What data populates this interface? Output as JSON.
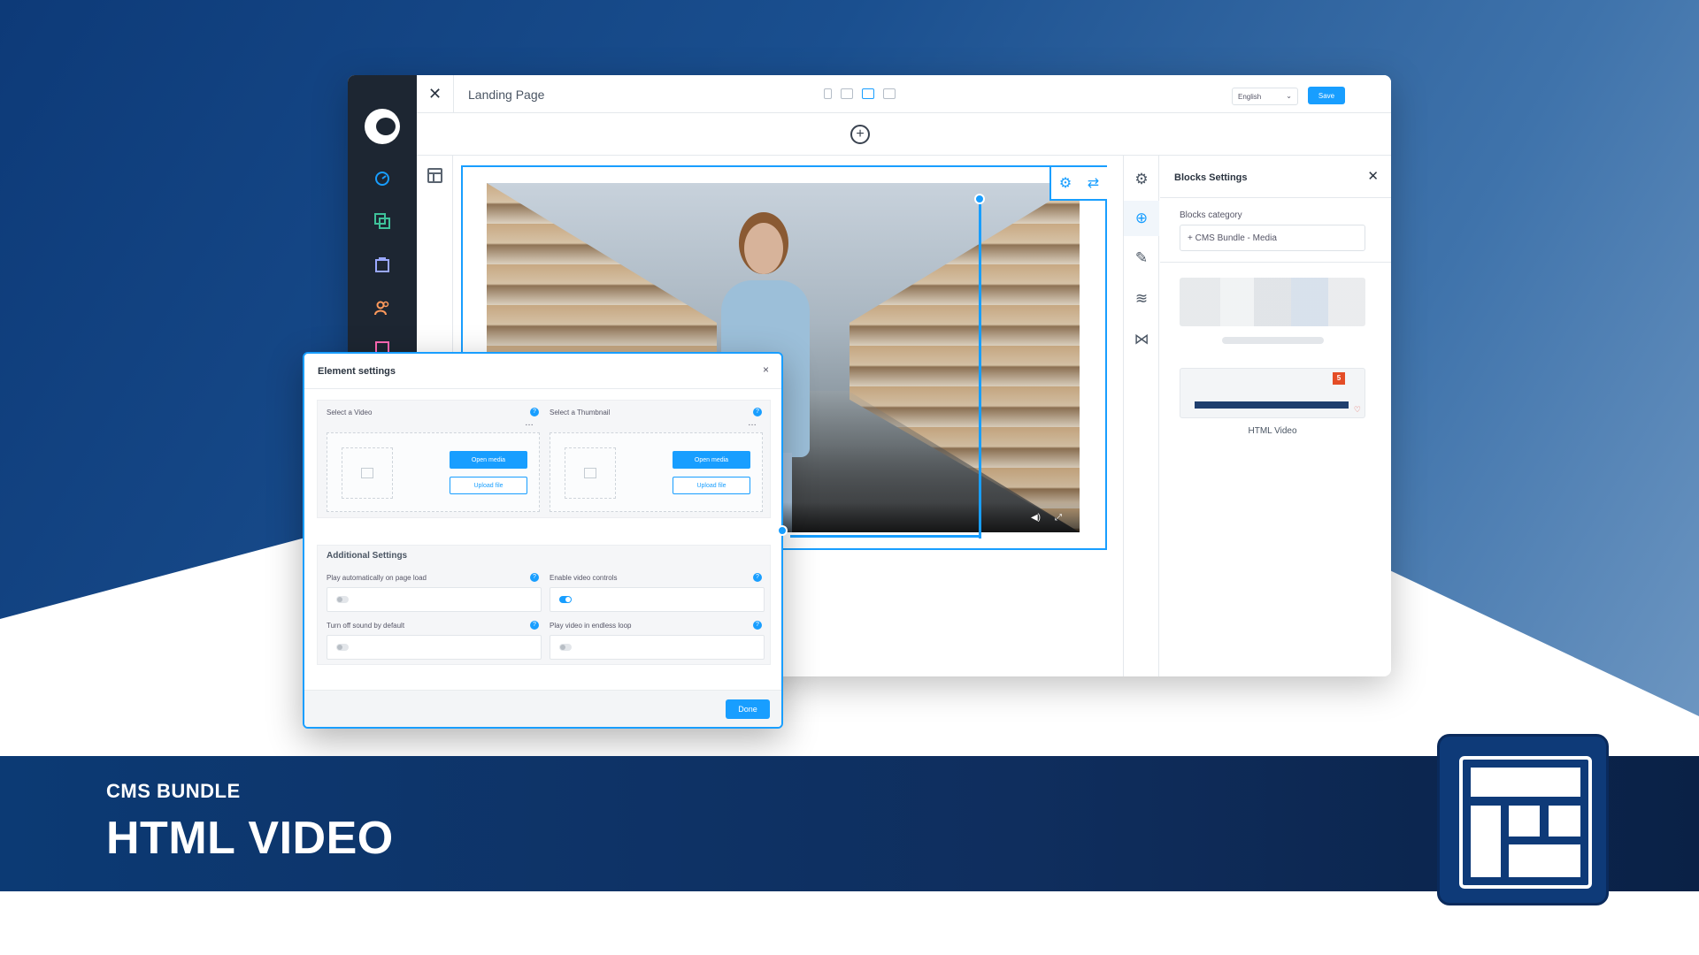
{
  "editor": {
    "page_name": "Landing Page",
    "language": "English",
    "save_label": "Save"
  },
  "blocks_panel": {
    "title": "Blocks Settings",
    "category_label": "Blocks category",
    "category_value": "+ CMS Bundle - Media",
    "html_video_label": "HTML Video",
    "html5_badge": "5"
  },
  "modal": {
    "title": "Element settings",
    "close": "×",
    "select_video": "Select a Video",
    "select_thumbnail": "Select a Thumbnail",
    "open_media": "Open media",
    "upload_file": "Upload file",
    "additional_settings": "Additional Settings",
    "autoplay": {
      "label": "Play automatically on page load",
      "enabled": false
    },
    "controls": {
      "label": "Enable video controls",
      "enabled": true
    },
    "mute": {
      "label": "Turn off sound by default",
      "enabled": false
    },
    "loop": {
      "label": "Play video in endless loop",
      "enabled": false
    },
    "done": "Done"
  },
  "banner": {
    "kicker": "CMS BUNDLE",
    "title": "HTML VIDEO"
  },
  "icons": {
    "sidebar": [
      "dashboard-icon",
      "catalog-icon",
      "orders-icon",
      "customers-icon",
      "content-icon"
    ],
    "rail": [
      "settings-icon",
      "add-block-icon",
      "edit-icon",
      "layers-icon",
      "share-icon"
    ]
  },
  "colors": {
    "accent": "#189eff",
    "sidebar": "#1d2632",
    "banner": "#0f2e5e"
  }
}
